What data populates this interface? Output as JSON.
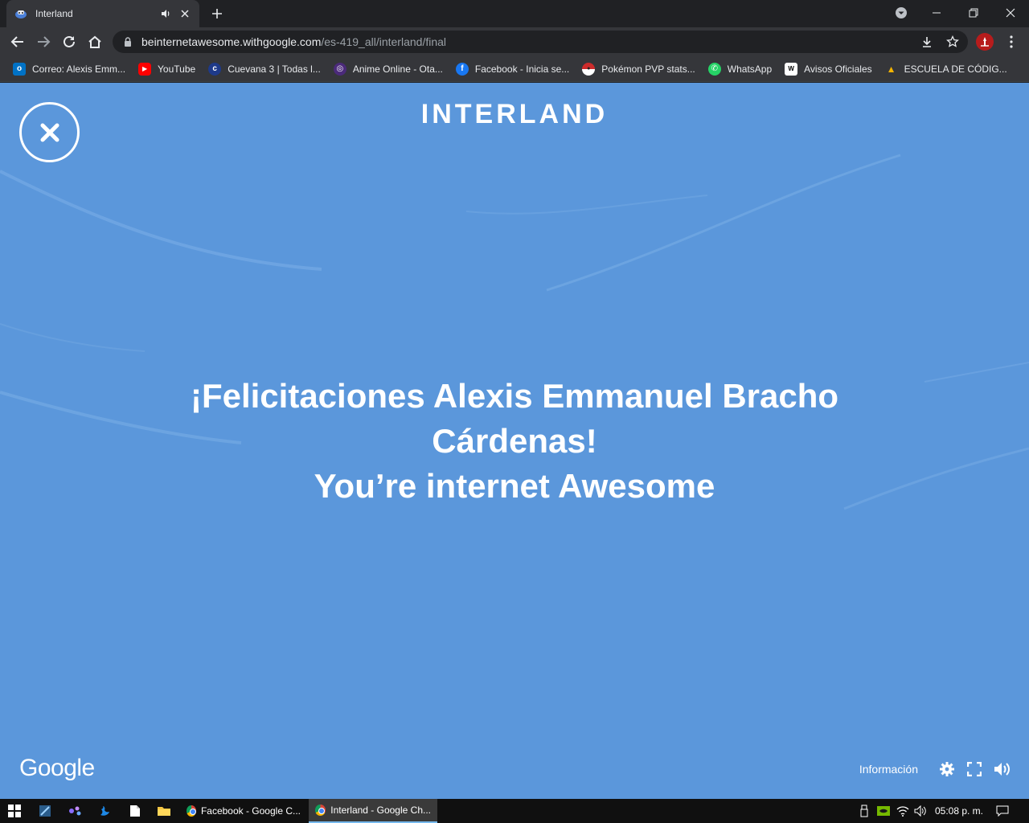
{
  "browser": {
    "tab": {
      "title": "Interland"
    },
    "address_bar": {
      "host": "beinternetawesome.withgoogle.com",
      "path": "/es-419_all/interland/final"
    },
    "bookmarks": [
      {
        "label": "Correo: Alexis Emm...",
        "icon": "outlook-icon",
        "color": "#0072c6",
        "glyph": "o"
      },
      {
        "label": "YouTube",
        "icon": "youtube-icon",
        "color": "#ff0000",
        "glyph": "▶"
      },
      {
        "label": "Cuevana 3 | Todas l...",
        "icon": "cuevana-icon",
        "color": "#1e3a8a",
        "glyph": "c"
      },
      {
        "label": "Anime Online - Ota...",
        "icon": "anime-icon",
        "color": "#4b2a7a",
        "glyph": "◎"
      },
      {
        "label": "Facebook - Inicia se...",
        "icon": "facebook-icon",
        "color": "#1877f2",
        "glyph": "f"
      },
      {
        "label": "Pokémon PVP stats...",
        "icon": "pokeball-icon",
        "color": "#cc2b2b",
        "glyph": "●"
      },
      {
        "label": "WhatsApp",
        "icon": "whatsapp-icon",
        "color": "#25d366",
        "glyph": "✆"
      },
      {
        "label": "Avisos Oficiales",
        "icon": "wix-icon",
        "color": "#ffffff",
        "glyph": "W"
      },
      {
        "label": "ESCUELA DE CÓDIG...",
        "icon": "google-drive-icon",
        "color": "#0f9d58",
        "glyph": "▲"
      }
    ]
  },
  "page": {
    "brand": "INTERLAND",
    "message_line1": "¡Felicitaciones Alexis Emmanuel Bracho",
    "message_line2": "Cárdenas!",
    "message_line3": "You’re internet Awesome",
    "google_logo": "Google",
    "info_link": "Información",
    "background_color": "#5b97db"
  },
  "taskbar": {
    "apps": [
      {
        "label": "Facebook - Google C...",
        "active": false
      },
      {
        "label": "Interland - Google Ch...",
        "active": true
      }
    ],
    "clock": "05:08 p. m."
  }
}
